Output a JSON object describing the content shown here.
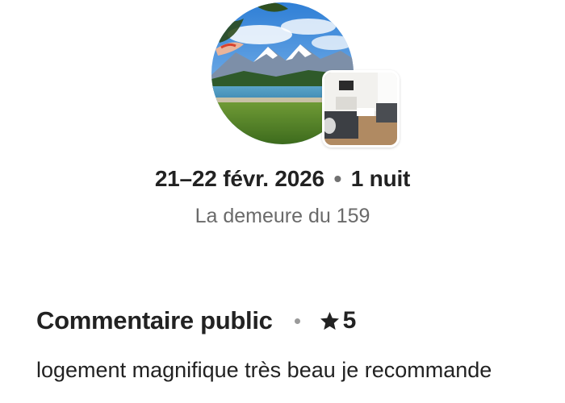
{
  "stay": {
    "dates": "21–22 févr. 2026",
    "separator": "•",
    "nights": "1 nuit",
    "listing_name": "La demeure du 159"
  },
  "review": {
    "title": "Commentaire public",
    "rating": "5",
    "text": "logement magnifique très beau je recommande"
  },
  "icons": {
    "rating": "star-icon",
    "main_photo": "lake-mountain-photo",
    "secondary_photo": "living-room-photo"
  },
  "colors": {
    "primary_text": "#222222",
    "secondary_text": "#6a6a6a",
    "dot": "#9a9a9a"
  }
}
